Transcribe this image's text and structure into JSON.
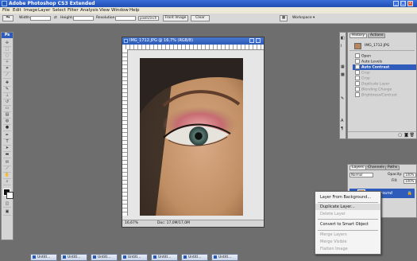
{
  "app": {
    "title": "Adobe Photoshop CS3 Extended"
  },
  "menu": [
    "File",
    "Edit",
    "Image",
    "Layer",
    "Select",
    "Filter",
    "Analysis",
    "View",
    "Window",
    "Help"
  ],
  "options": {
    "width_label": "Width:",
    "height_label": "Height:",
    "resolution_label": "Resolution:",
    "resolution_unit": "pixels/inch",
    "front_image": "Front Image",
    "clear": "Clear",
    "workspace": "Workspace"
  },
  "tools": {
    "header": "Ps"
  },
  "document": {
    "title": "IMG_1712.JPG @ 16,7% (RGB/8)",
    "zoom": "16,67%",
    "doc_size": "Doc: 17,0M/17,0M"
  },
  "history": {
    "tabs": [
      "History",
      "Actions"
    ],
    "snapshot": "IMG_1712.JPG",
    "items": [
      {
        "label": "Open",
        "state": "normal"
      },
      {
        "label": "Auto Levels",
        "state": "normal"
      },
      {
        "label": "Auto Contrast",
        "state": "active"
      },
      {
        "label": "Crop",
        "state": "dim"
      },
      {
        "label": "Crop",
        "state": "dim"
      },
      {
        "label": "Duplicate Layer",
        "state": "dim"
      },
      {
        "label": "Blending Change",
        "state": "dim"
      },
      {
        "label": "Brightness/Contrast",
        "state": "dim"
      }
    ]
  },
  "layers": {
    "tabs": [
      "Layers",
      "Channels",
      "Paths"
    ],
    "blend_mode": "Normal",
    "opacity_label": "Opacity:",
    "opacity": "100%",
    "fill_label": "Fill:",
    "fill": "100%",
    "layer_name": "Background"
  },
  "context_menu": {
    "items": [
      {
        "label": "Layer From Background...",
        "state": "enabled"
      },
      {
        "label": "Duplicate Layer...",
        "state": "highlighted"
      },
      {
        "label": "Delete Layer",
        "state": "disabled"
      },
      {
        "label": "Convert to Smart Object",
        "state": "enabled"
      },
      {
        "label": "Merge Layers",
        "state": "disabled"
      },
      {
        "label": "Merge Visible",
        "state": "disabled"
      },
      {
        "label": "Flatten Image",
        "state": "disabled"
      }
    ]
  },
  "taskbar_tabs": [
    "Untitl...",
    "Untitl...",
    "Untitl...",
    "Untitl...",
    "Untitl...",
    "Untitl...",
    "Untitl..."
  ]
}
